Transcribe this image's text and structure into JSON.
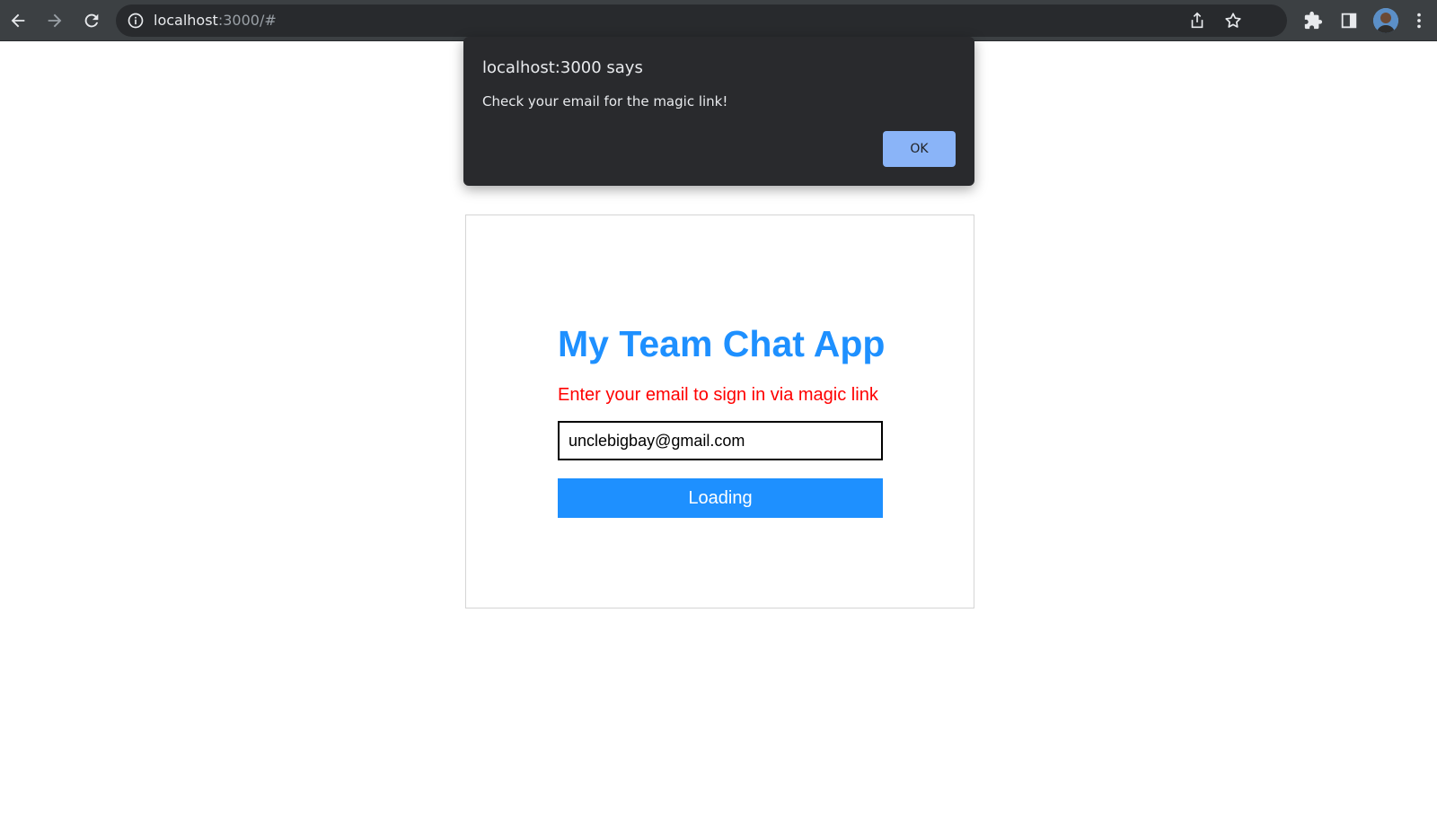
{
  "browser": {
    "url_host": "localhost",
    "url_rest": ":3000/#"
  },
  "dialog": {
    "title": "localhost:3000 says",
    "message": "Check your email for the magic link!",
    "ok_label": "OK"
  },
  "login": {
    "title": "My Team Chat App",
    "subtitle": "Enter your email to sign in via magic link",
    "email_value": "unclebigbay@gmail.com",
    "button_label": "Loading"
  },
  "colors": {
    "accent": "#1e90ff",
    "subtitle": "#ff0000",
    "dialog_bg": "#292a2d",
    "dialog_button": "#8ab4f8",
    "toolbar_bg": "#3c4043"
  }
}
